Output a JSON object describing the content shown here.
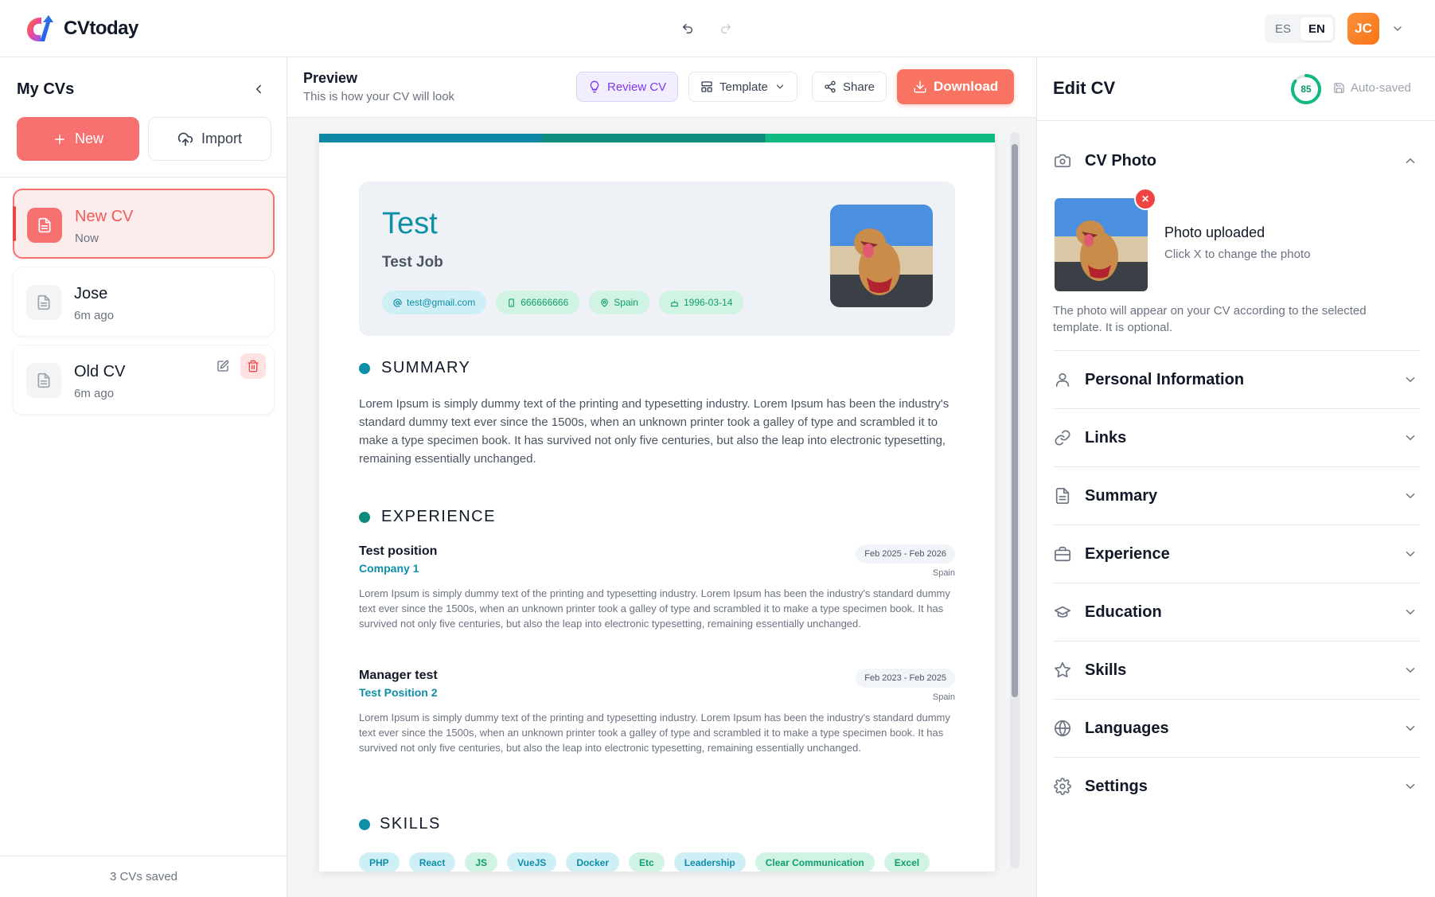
{
  "app": {
    "name": "CVtoday"
  },
  "header": {
    "undo_icon": "undo-icon",
    "redo_icon": "redo-icon",
    "languages": [
      "ES",
      "EN"
    ],
    "active_language": "EN",
    "user_initials": "JC"
  },
  "sidebar": {
    "title": "My CVs",
    "new_label": "New",
    "import_label": "Import",
    "items": [
      {
        "name": "New CV",
        "time": "Now",
        "active": true
      },
      {
        "name": "Jose",
        "time": "6m ago",
        "active": false
      },
      {
        "name": "Old CV",
        "time": "6m ago",
        "active": false
      }
    ],
    "footer": "3 CVs saved"
  },
  "preview": {
    "title": "Preview",
    "subtitle": "This is how your CV will look",
    "review_label": "Review CV",
    "template_label": "Template",
    "share_label": "Share",
    "download_label": "Download"
  },
  "cv": {
    "name": "Test",
    "job": "Test Job",
    "email": "test@gmail.com",
    "phone": "666666666",
    "location": "Spain",
    "birthdate": "1996-03-14",
    "summary_title": "SUMMARY",
    "summary": "Lorem Ipsum is simply dummy text of the printing and typesetting industry. Lorem Ipsum has been the industry's standard dummy text ever since the 1500s, when an unknown printer took a galley of type and scrambled it to make a type specimen book. It has survived not only five centuries, but also the leap into electronic typesetting, remaining essentially unchanged.",
    "experience_title": "EXPERIENCE",
    "experience": [
      {
        "position": "Test position",
        "company": "Company 1",
        "dates": "Feb 2025 - Feb 2026",
        "location": "Spain",
        "description": "Lorem Ipsum is simply dummy text of the printing and typesetting industry. Lorem Ipsum has been the industry's standard dummy text ever since the 1500s, when an unknown printer took a galley of type and scrambled it to make a type specimen book. It has survived not only five centuries, but also the leap into electronic typesetting, remaining essentially unchanged."
      },
      {
        "position": "Manager test",
        "company": "Test Position 2",
        "dates": "Feb 2023 - Feb 2025",
        "location": "Spain",
        "description": "Lorem Ipsum is simply dummy text of the printing and typesetting industry. Lorem Ipsum has been the industry's standard dummy text ever since the 1500s, when an unknown printer took a galley of type and scrambled it to make a type specimen book. It has survived not only five centuries, but also the leap into electronic typesetting, remaining essentially unchanged."
      }
    ],
    "skills_title": "SKILLS",
    "skills": [
      "PHP",
      "React",
      "JS",
      "VueJS",
      "Docker",
      "Etc",
      "Leadership",
      "Clear Communication",
      "Excel"
    ]
  },
  "edit": {
    "title": "Edit CV",
    "score": "85",
    "autosave_label": "Auto-saved",
    "photo_section": "CV Photo",
    "photo_uploaded": "Photo uploaded",
    "photo_hint": "Click X to change the photo",
    "photo_note": "The photo will appear on your CV according to the selected template. It is optional.",
    "sections": [
      "Personal Information",
      "Links",
      "Summary",
      "Experience",
      "Education",
      "Skills",
      "Languages",
      "Settings"
    ]
  },
  "colors": {
    "accent_red": "#f87171",
    "accent_teal": "#0e8fa8",
    "accent_green": "#10b981",
    "review_purple": "#7c3aed"
  }
}
